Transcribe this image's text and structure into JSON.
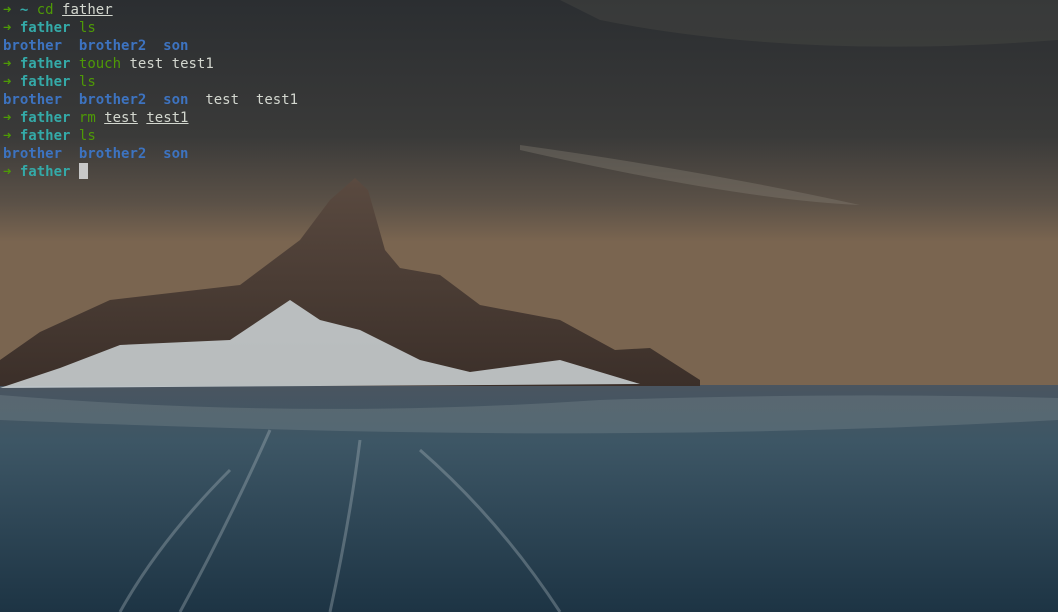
{
  "colors": {
    "prompt_arrow": "#4e9a06",
    "prompt_dir": "#34aaa8",
    "command": "#4e9a06",
    "directory_listing": "#3d73c0",
    "file_listing": "#d3d7cf",
    "cursor": "#c8c8c8"
  },
  "prompt_symbol": "➜",
  "terminal": {
    "lines": [
      {
        "type": "prompt",
        "dir": "~",
        "cmd": "cd",
        "args": [
          {
            "text": "father",
            "underline": true
          }
        ]
      },
      {
        "type": "prompt",
        "dir": "father",
        "cmd": "ls",
        "args": []
      },
      {
        "type": "output",
        "entries": [
          {
            "text": "brother",
            "kind": "dir"
          },
          {
            "text": "brother2",
            "kind": "dir"
          },
          {
            "text": "son",
            "kind": "dir"
          }
        ]
      },
      {
        "type": "prompt",
        "dir": "father",
        "cmd": "touch",
        "args": [
          {
            "text": "test",
            "underline": false
          },
          {
            "text": "test1",
            "underline": false
          }
        ]
      },
      {
        "type": "prompt",
        "dir": "father",
        "cmd": "ls",
        "args": []
      },
      {
        "type": "output",
        "entries": [
          {
            "text": "brother",
            "kind": "dir"
          },
          {
            "text": "brother2",
            "kind": "dir"
          },
          {
            "text": "son",
            "kind": "dir"
          },
          {
            "text": "test",
            "kind": "file"
          },
          {
            "text": "test1",
            "kind": "file"
          }
        ]
      },
      {
        "type": "prompt",
        "dir": "father",
        "cmd": "rm",
        "args": [
          {
            "text": "test",
            "underline": true
          },
          {
            "text": "test1",
            "underline": true
          }
        ]
      },
      {
        "type": "prompt",
        "dir": "father",
        "cmd": "ls",
        "args": []
      },
      {
        "type": "output",
        "entries": [
          {
            "text": "brother",
            "kind": "dir"
          },
          {
            "text": "brother2",
            "kind": "dir"
          },
          {
            "text": "son",
            "kind": "dir"
          }
        ]
      },
      {
        "type": "prompt",
        "dir": "father",
        "cmd": "",
        "args": [],
        "cursor": true
      }
    ]
  }
}
